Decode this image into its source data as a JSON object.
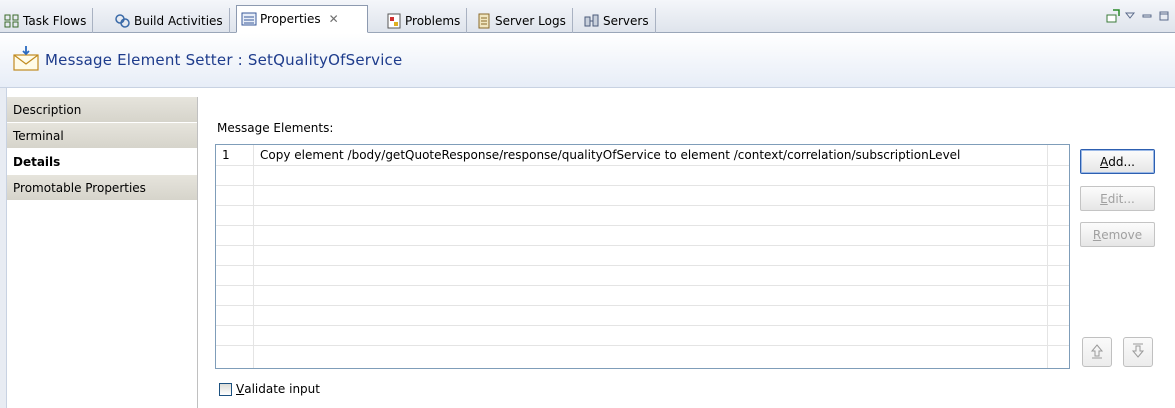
{
  "tabs": [
    {
      "label": "Task Flows",
      "icon": "task-flows-icon"
    },
    {
      "label": "Build Activities",
      "icon": "build-activities-icon"
    },
    {
      "label": "Properties",
      "icon": "properties-icon",
      "active": true,
      "close": "✕"
    },
    {
      "label": "Problems",
      "icon": "problems-icon"
    },
    {
      "label": "Server Logs",
      "icon": "server-logs-icon"
    },
    {
      "label": "Servers",
      "icon": "servers-icon"
    }
  ],
  "window_controls": {
    "pin": "pin-icon",
    "menu": "view-menu-icon",
    "minimize": "minimize-icon",
    "maximize": "maximize-icon"
  },
  "header": {
    "title": "Message Element Setter : SetQualityOfService",
    "icon": "message-envelope-icon"
  },
  "sidebar": {
    "items": [
      {
        "label": "Description"
      },
      {
        "label": "Terminal"
      },
      {
        "label": "Details",
        "selected": true
      },
      {
        "label": "Promotable Properties"
      }
    ]
  },
  "details": {
    "section_label": "Message Elements:",
    "rows": [
      {
        "num": "1",
        "text": "Copy element /body/getQuoteResponse/response/qualityOfService to element /context/correlation/subscriptionLevel"
      }
    ],
    "buttons": {
      "add": {
        "mnemonic": "A",
        "rest": "dd..."
      },
      "edit": {
        "mnemonic": "E",
        "rest": "dit..."
      },
      "remove": {
        "mnemonic": "R",
        "rest": "emove"
      }
    },
    "move_up_icon": "move-up-icon",
    "move_down_icon": "move-down-icon",
    "validate": {
      "mnemonic": "V",
      "rest": "alidate input",
      "checked": false
    }
  },
  "colors": {
    "title": "#1e3c8c",
    "accent_border": "#7f9db9",
    "disabled_text": "#a0a0a0"
  }
}
